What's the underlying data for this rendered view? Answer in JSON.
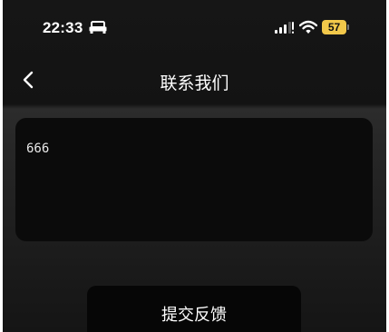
{
  "status_bar": {
    "time": "22:33",
    "battery_level": "57",
    "icons": [
      "car-icon",
      "signal-icon",
      "wifi-icon",
      "battery-icon"
    ],
    "battery_color": "#f2c84a"
  },
  "nav": {
    "back_icon": "chevron-left-icon",
    "title": "联系我们"
  },
  "form": {
    "feedback_value": "666",
    "submit_label": "提交反馈"
  },
  "colors": {
    "background": "#1a1a1a",
    "input_background": "#0b0b0b",
    "button_background": "#060606",
    "text": "#ffffff"
  }
}
